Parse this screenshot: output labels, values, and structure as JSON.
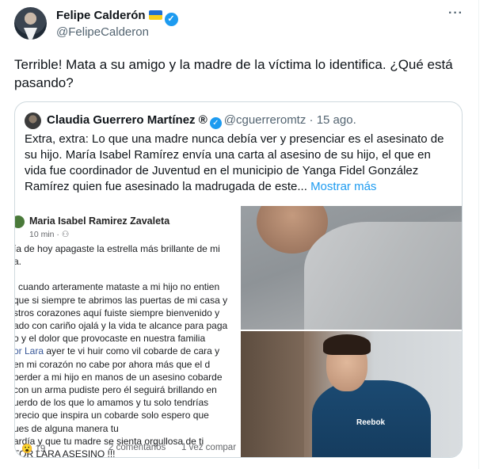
{
  "tweet": {
    "author_name": "Felipe Calderón",
    "author_handle": "@FelipeCalderon",
    "more_glyph": "···",
    "text_line1": "Terrible! Mata a su amigo y la madre de la víctima lo identifica. ¿Qué está",
    "text_line2": "pasando?"
  },
  "quote": {
    "author_name": "Claudia Guerrero Martínez ®",
    "author_handle": "@cguerreromtz",
    "separator": "·",
    "date": "15 ago.",
    "text": "Extra, extra: Lo que una madre nunca debía ver y presenciar es el asesinato de su hijo. María Isabel Ramírez envía una carta al asesino de su hijo, el que en vida fue coordinador de Juventud en el municipio de Yanga Fidel González Ramírez quien fue asesinado la madrugada de este...",
    "show_more": "Mostrar más"
  },
  "fb_post": {
    "author": "Maria Isabel Ramirez Zavaleta",
    "meta": "10 min · ⚇",
    "lines": [
      "ía de hoy apagaste la estrella más brillante de mi",
      "a.",
      "",
      "i cuando arteramente mataste a mi hijo no entien",
      "que si siempre te abrimos las puertas de mi casa y",
      "stros corazones aquí fuiste siempre bienvenido y",
      "ado con cariño ojalá y la vida te alcance para paga",
      "o y el dolor que provocaste en nuestra familia"
    ],
    "link": "or Lara",
    "line_after_link": " ayer te vi huir  como vil cobarde de cara y",
    "lines2": [
      " en mi corazón no cabe por ahora más que el d",
      "perder a mi hijo en manos de un asesino cobarde",
      " con un arma pudiste pero él seguirá brillando en",
      "uerdo de los que lo amamos y tu solo tendrías",
      "precio que inspira un cobarde solo espero que",
      "ues de alguna manera tu",
      "ardía y que tu madre se sienta orgullosa de ti",
      "TOR LARA ASESINO !!!"
    ],
    "reactions": "😮 19",
    "comments": "2 comentarios",
    "shares": "1 vez compar"
  },
  "photo": {
    "brand": "Reebok"
  },
  "colors": {
    "accent": "#1d9bf0",
    "secondary_text": "#536471",
    "border": "#cfd9de"
  }
}
